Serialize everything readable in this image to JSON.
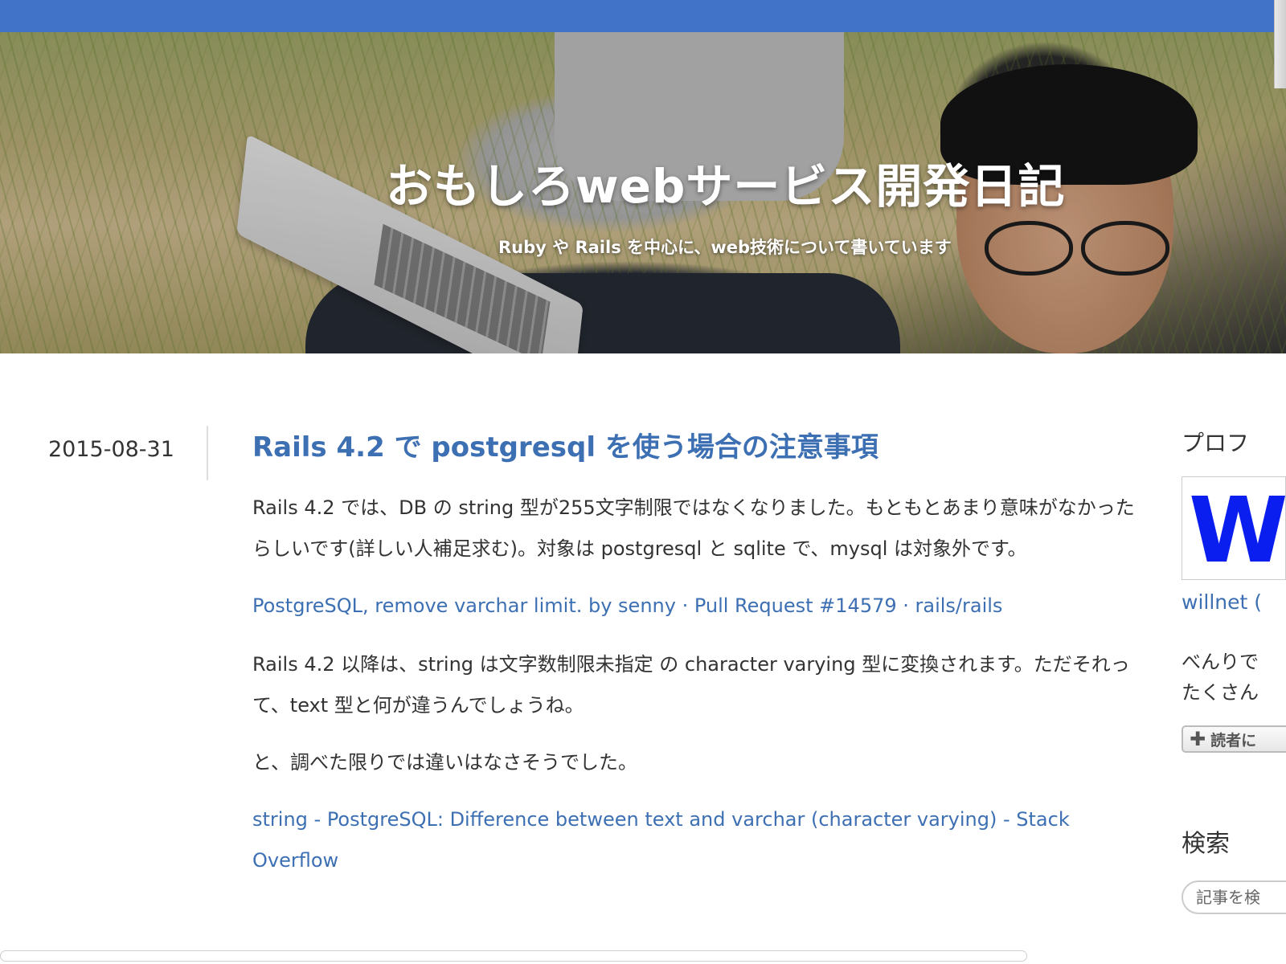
{
  "blog": {
    "title": "おもしろwebサービス開発日記",
    "description": "Ruby や Rails を中心に、web技術について書いています"
  },
  "entry": {
    "date": "2015-08-31",
    "title": "Rails 4.2 で postgresql を使う場合の注意事項",
    "paragraph1": "Rails 4.2 では、DB の string 型が255文字制限ではなくなりました。もともとあまり意味がなかったらしいです(詳しい人補足求む)。対象は postgresql と sqlite で、mysql は対象外です。",
    "link1": "PostgreSQL, remove varchar limit. by senny · Pull Request #14579 · rails/rails",
    "paragraph2": "Rails 4.2 以降は、string は文字数制限未指定 の character varying 型に変換されます。ただそれって、text 型と何が違うんでしょうね。",
    "paragraph3": "と、調べた限りでは違いはなさそうでした。",
    "link2": "string - PostgreSQL: Difference between text and varchar (character varying) - Stack Overflow"
  },
  "sidebar": {
    "profile_heading": "プロフ",
    "profile_name": "willnet (",
    "profile_bio_line1": "べんりで",
    "profile_bio_line2": "たくさん",
    "reader_button": "読者に",
    "search_heading": "検索",
    "search_placeholder": "記事を検"
  },
  "colors": {
    "topbar": "#4173c8",
    "link": "#3d6fb3",
    "text": "#333333"
  }
}
